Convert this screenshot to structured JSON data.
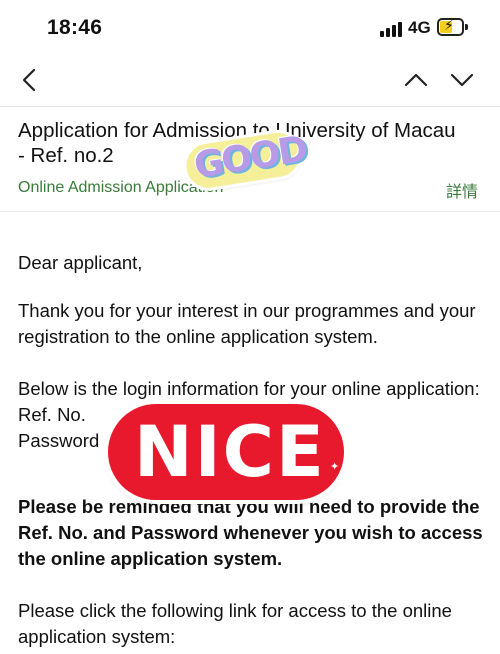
{
  "status_bar": {
    "time": "18:46",
    "network": "4G"
  },
  "email": {
    "subject": "Application for Admission to University of Macau - Ref. no.2",
    "sender": "Online Admission Application",
    "details_label": "詳情"
  },
  "body": {
    "greeting": "Dear applicant,",
    "thanks": "Thank you for your interest in our programmes and your registration to the online application system.",
    "login_intro": "Below is the login information for your online application:",
    "ref_label": "Ref. No.",
    "password_label": "Password",
    "reminder": "Please be reminded that you will need to provide the Ref. No. and Password whenever you wish to access the online application system.",
    "link_intro": "Please click the following link for access to the online application system:"
  },
  "stickers": {
    "good": "GOOD",
    "nice": "NICE"
  },
  "colors": {
    "accent_green": "#3a7a3a",
    "nice_red": "#e8192c",
    "battery_yellow": "#f2cf1c"
  }
}
